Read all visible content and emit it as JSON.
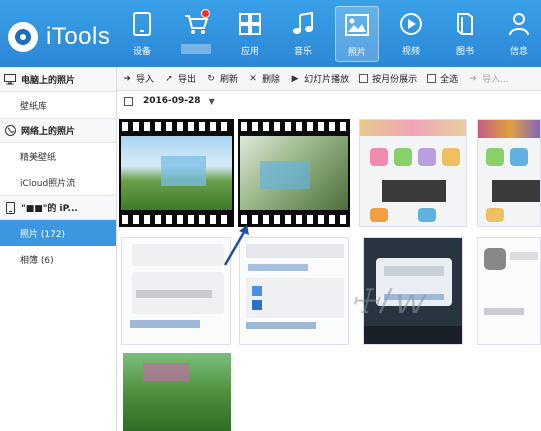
{
  "app": {
    "logo_text": "iTools"
  },
  "nav": [
    {
      "label": "设备",
      "icon": "device-icon"
    },
    {
      "label": "",
      "icon": "store-cart-icon",
      "badge": true
    },
    {
      "label": "应用",
      "icon": "apps-grid-icon"
    },
    {
      "label": "音乐",
      "icon": "music-note-icon"
    },
    {
      "label": "照片",
      "icon": "photo-icon",
      "active": true
    },
    {
      "label": "视频",
      "icon": "video-play-icon"
    },
    {
      "label": "图书",
      "icon": "book-icon"
    },
    {
      "label": "信息",
      "icon": "person-icon"
    }
  ],
  "toolbar": {
    "import": "导入",
    "export": "导出",
    "refresh": "刷新",
    "delete": "删除",
    "slideshow": "幻灯片播放",
    "by_month": "按月份展示",
    "select_all": "全选",
    "import_to_album": "导入..."
  },
  "sidebar": {
    "sec_pc": "电脑上的照片",
    "wallpaper_lib": "壁纸库",
    "sec_net": "网络上的照片",
    "fine_wallpaper": "精美壁纸",
    "icloud_stream": "iCloud照片流",
    "sec_device": "\"■■\"的 iP...",
    "photos": "照片 (172)",
    "albums": "相簿 (6)"
  },
  "content": {
    "date": "2016-09-28"
  },
  "colors": {
    "header_blue": "#2b87d6",
    "selection_blue": "#3d97e0",
    "badge_red": "#ff2a2a",
    "arrow_blue": "#1f4fa8"
  }
}
